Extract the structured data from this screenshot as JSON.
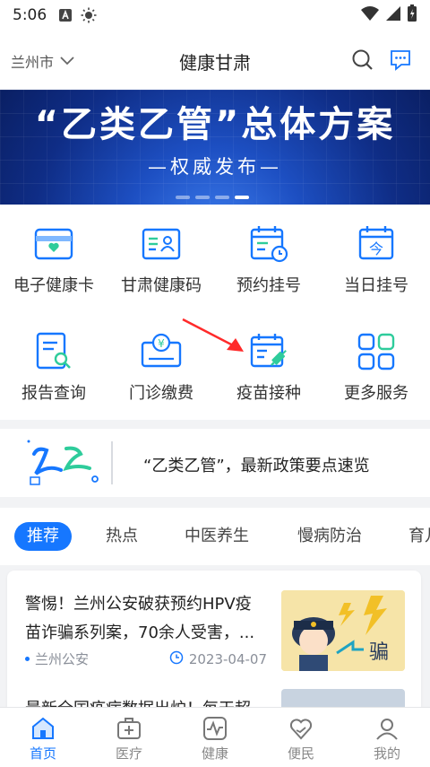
{
  "status": {
    "time": "5:06"
  },
  "header": {
    "city": "兰州市",
    "title": "健康甘肃"
  },
  "banner": {
    "headline": "“乙类乙管”总体方案",
    "sub": "—权威发布—",
    "active_dot": 4
  },
  "services": [
    {
      "label": "电子健康卡",
      "icon": "health-card-icon"
    },
    {
      "label": "甘肃健康码",
      "icon": "health-code-icon"
    },
    {
      "label": "预约挂号",
      "icon": "appointment-icon"
    },
    {
      "label": "当日挂号",
      "icon": "today-register-icon"
    },
    {
      "label": "报告查询",
      "icon": "report-search-icon"
    },
    {
      "label": "门诊缴费",
      "icon": "outpatient-pay-icon"
    },
    {
      "label": "疫苗接种",
      "icon": "vaccine-icon"
    },
    {
      "label": "更多服务",
      "icon": "more-services-icon"
    }
  ],
  "news_strip": {
    "text": "“乙类乙管”，最新政策要点速览"
  },
  "tabs": [
    "推荐",
    "热点",
    "中医养生",
    "慢病防治",
    "育儿"
  ],
  "articles": [
    {
      "title": "警惕！兰州公安破获预约HPV疫苗诈骗系列案，70余人受害，...",
      "source": "兰州公安",
      "date": "2023-04-07",
      "thumb_text": "骗"
    },
    {
      "title": "最新全国疫病数据出炉！每天超"
    }
  ],
  "bottom_nav": [
    {
      "label": "首页",
      "icon": "home-icon"
    },
    {
      "label": "医疗",
      "icon": "medical-kit-icon"
    },
    {
      "label": "健康",
      "icon": "pulse-icon"
    },
    {
      "label": "便民",
      "icon": "heart-hand-icon"
    },
    {
      "label": "我的",
      "icon": "user-icon"
    }
  ],
  "colors": {
    "accent": "#1677ff",
    "banner": "#1d4fc2"
  }
}
